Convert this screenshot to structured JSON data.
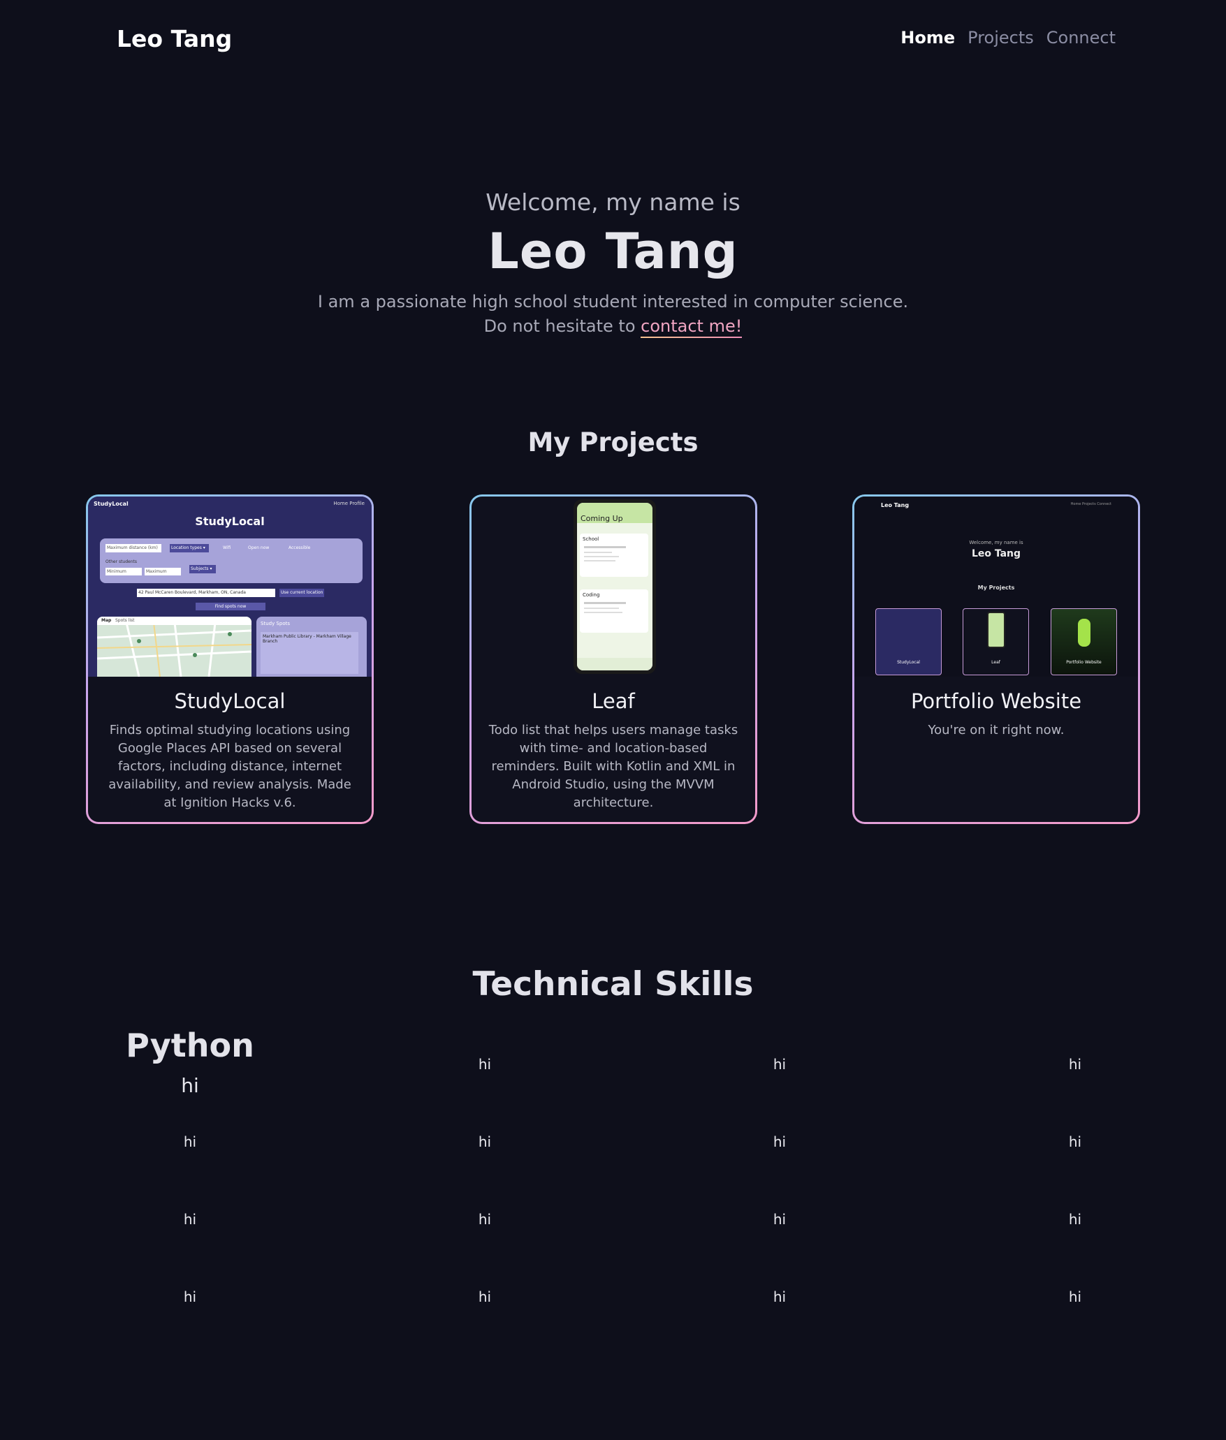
{
  "nav": {
    "brand": "Leo Tang",
    "links": [
      {
        "label": "Home",
        "active": true
      },
      {
        "label": "Projects",
        "active": false
      },
      {
        "label": "Connect",
        "active": false
      }
    ]
  },
  "hero": {
    "welcome": "Welcome, my name is",
    "name": "Leo Tang",
    "tagline": "I am a passionate high school student interested in computer science.",
    "contact_prefix": "Do not hesitate to",
    "contact_link": "contact me!"
  },
  "projects": {
    "title": "My Projects",
    "items": [
      {
        "title": "StudyLocal",
        "description": "Finds optimal studying locations using Google Places API based on several factors, including distance, internet availability, and review analysis. Made at Ignition Hacks v.6.",
        "shot": {
          "brand": "StudyLocal",
          "nav": "Home  Profile",
          "heading": "StudyLocal",
          "max_distance": "Maximum distance (km)",
          "location_types": "Location types ▾",
          "wifi": "Wifi",
          "open_now": "Open now",
          "accessible": "Accessible",
          "other_students": "Other students",
          "minimum": "Minimum",
          "maximum": "Maximum",
          "subjects": "Subjects ▾",
          "address": "42 Paul McCaren Boulevard, Markham, ON, Canada",
          "use_location": "Use current location",
          "find": "Find spots now",
          "map_tab": "Map",
          "spots_tab": "Spots list",
          "spots_heading": "Study Spots",
          "spot_name": "Markham Public Library - Markham Village Branch"
        }
      },
      {
        "title": "Leaf",
        "description": "Todo list that helps users manage tasks with time- and location-based reminders. Built with Kotlin and XML in Android Studio, using the MVVM architecture.",
        "shot": {
          "heading": "Coming Up",
          "group1": "School",
          "group2": "Coding"
        }
      },
      {
        "title": "Portfolio Website",
        "description": "You're on it right now.",
        "shot": {
          "brand": "Leo Tang",
          "nav": "Home  Projects  Connect",
          "welcome": "Welcome, my name is",
          "name": "Leo Tang",
          "projects": "My Projects",
          "c1": "StudyLocal",
          "c2": "Leaf",
          "c3": "Portfolio Website"
        }
      }
    ]
  },
  "skills": {
    "title": "Technical Skills",
    "python_title": "Python",
    "python_sub": "hi",
    "grid": [
      [
        "hi",
        "hi",
        "hi"
      ],
      [
        "hi",
        "hi",
        "hi",
        "hi"
      ],
      [
        "hi",
        "hi",
        "hi",
        "hi"
      ],
      [
        "hi",
        "hi",
        "hi",
        "hi"
      ]
    ]
  },
  "colors": {
    "background": "#0e0f1b",
    "accent_link": "#f0a5c2",
    "card_border_start": "#86c8ec",
    "card_border_end": "#f39ac9"
  }
}
